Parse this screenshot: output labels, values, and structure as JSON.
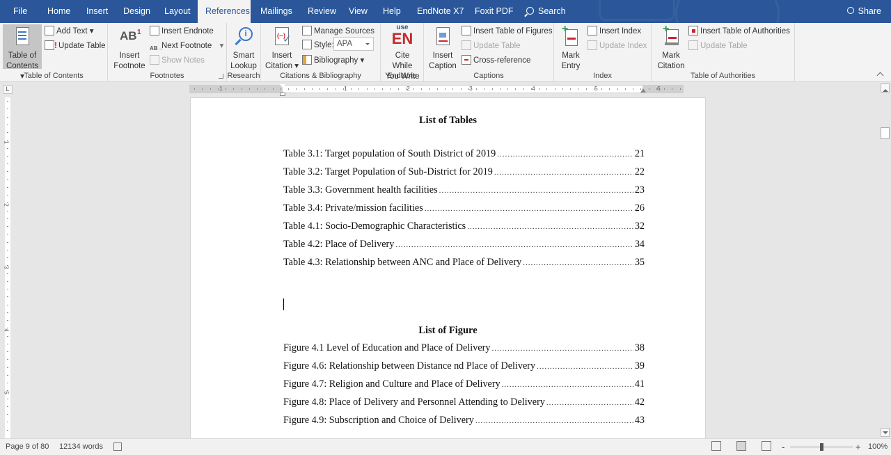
{
  "tabs": [
    {
      "label": "File"
    },
    {
      "label": "Home"
    },
    {
      "label": "Insert"
    },
    {
      "label": "Design"
    },
    {
      "label": "Layout"
    },
    {
      "label": "References"
    },
    {
      "label": "Mailings"
    },
    {
      "label": "Review"
    },
    {
      "label": "View"
    },
    {
      "label": "Help"
    },
    {
      "label": "EndNote X7"
    },
    {
      "label": "Foxit PDF"
    }
  ],
  "search_label": "Search",
  "share_label": "Share",
  "ribbon": {
    "toc": {
      "group_label": "Table of Contents",
      "table_of_contents": "Table of",
      "table_of_contents_2": "Contents",
      "add_text": "Add Text",
      "update_table": "Update Table"
    },
    "footnotes": {
      "group_label": "Footnotes",
      "insert_footnote": "Insert",
      "insert_footnote_2": "Footnote",
      "insert_endnote": "Insert Endnote",
      "next_footnote": "Next Footnote",
      "show_notes": "Show Notes"
    },
    "research": {
      "group_label": "Research",
      "smart_lookup": "Smart",
      "smart_lookup_2": "Lookup"
    },
    "citations": {
      "group_label": "Citations & Bibliography",
      "insert_citation": "Insert",
      "insert_citation_2": "Citation",
      "manage_sources": "Manage Sources",
      "style_label": "Style:",
      "style_value": "APA",
      "bibliography": "Bibliography"
    },
    "endnote": {
      "group_label": "EndNote",
      "use": "use",
      "en": "EN",
      "cite_while": "Cite While",
      "you_write": "You Write"
    },
    "captions": {
      "group_label": "Captions",
      "insert_caption": "Insert",
      "insert_caption_2": "Caption",
      "insert_table_of_figures": "Insert Table of Figures",
      "update_table": "Update Table",
      "cross_reference": "Cross-reference"
    },
    "index": {
      "group_label": "Index",
      "mark_entry": "Mark",
      "mark_entry_2": "Entry",
      "insert_index": "Insert Index",
      "update_index": "Update Index"
    },
    "authorities": {
      "group_label": "Table of Authorities",
      "mark_citation": "Mark",
      "mark_citation_2": "Citation",
      "insert_toa": "Insert Table of Authorities",
      "update_table": "Update Table"
    }
  },
  "ruler": {
    "corner": "L",
    "h_numbers": [
      "1",
      "1",
      "2",
      "3",
      "4",
      "5",
      "6"
    ],
    "v_numbers": [
      "1",
      "2",
      "3",
      "4",
      "5"
    ]
  },
  "document": {
    "list_of_tables_title": "List of Tables",
    "tables": [
      {
        "label": "Table 3.1: Target population of South District of 2019",
        "page": "21"
      },
      {
        "label": "Table 3.2: Target Population of Sub-District for 2019",
        "page": "22"
      },
      {
        "label": "Table 3.3: Government health facilities",
        "page": "23"
      },
      {
        "label": "Table 3.4: Private/mission facilities",
        "page": "26"
      },
      {
        "label": "Table 4.1: Socio-Demographic Characteristics",
        "page": "32"
      },
      {
        "label": "Table 4.2: Place of Delivery",
        "page": "34"
      },
      {
        "label": "Table 4.3: Relationship between ANC and Place of Delivery",
        "page": "35"
      }
    ],
    "list_of_figures_title": "List of Figure",
    "figures": [
      {
        "label": "Figure 4.1 Level of Education and Place of Delivery",
        "page": "38"
      },
      {
        "label": "Figure 4.6: Relationship between Distance nd Place of Delivery",
        "page": "39"
      },
      {
        "label": "Figure 4.7: Religion and Culture and Place of Delivery",
        "page": "41"
      },
      {
        "label": "Figure 4.8: Place of Delivery and Personnel Attending to Delivery",
        "page": "42"
      },
      {
        "label": "Figure 4.9: Subscription and Choice of Delivery",
        "page": "43"
      }
    ]
  },
  "status": {
    "page": "Page 9 of 80",
    "words": "12134 words",
    "zoom": "100%",
    "zoom_minus": "-",
    "zoom_plus": "+",
    "zoom_percent": 100
  },
  "colors": {
    "accent": "#2b579a",
    "endnote_red": "#c0282d"
  }
}
